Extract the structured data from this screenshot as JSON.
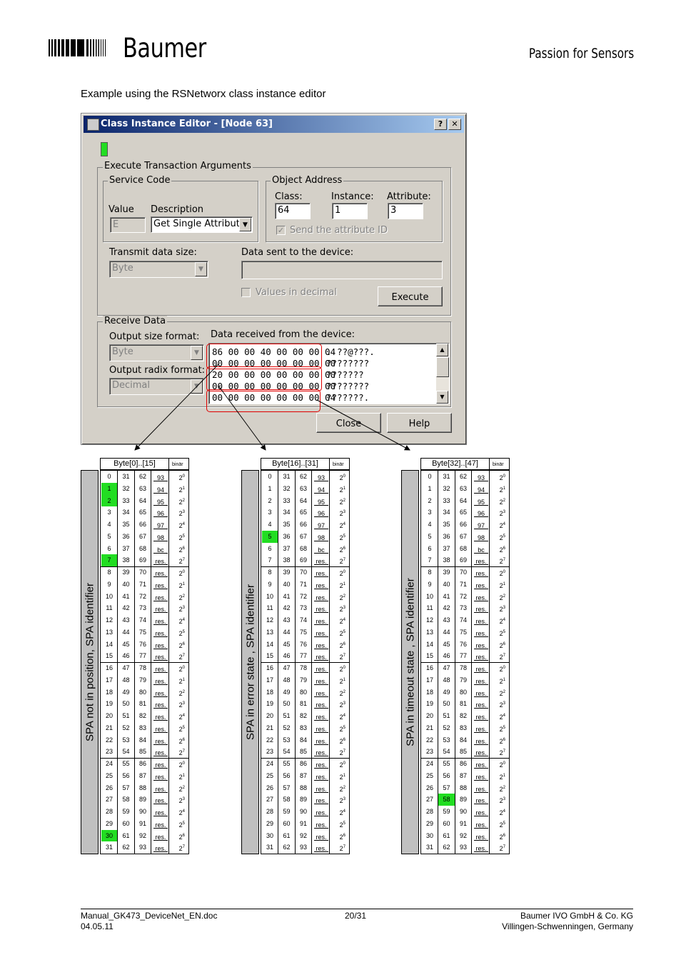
{
  "header": {
    "brand": "Baumer",
    "tagline": "Passion for Sensors"
  },
  "intro": "Example using the RSNetworx class instance editor",
  "dialog": {
    "title": "Class Instance Editor - [Node 63]",
    "help_btn": "?",
    "close_btn": "✕",
    "group_exec": "Execute Transaction Arguments",
    "group_service": "Service Code",
    "value_label": "Value",
    "value": "E",
    "desc_label": "Description",
    "desc_value": "Get Single Attribute",
    "group_object": "Object Address",
    "class_label": "Class:",
    "class_value": "64",
    "instance_label": "Instance:",
    "instance_value": "1",
    "attribute_label": "Attribute:",
    "attribute_value": "3",
    "send_attr_label": "Send the attribute ID",
    "transmit_label": "Transmit data size:",
    "transmit_value": "Byte",
    "data_sent_label": "Data sent to the device:",
    "values_decimal_label": "Values in decimal",
    "execute_btn": "Execute",
    "group_receive": "Receive Data",
    "output_size_label": "Output size format:",
    "output_size_value": "Byte",
    "output_radix_label": "Output radix format:",
    "output_radix_value": "Decimal",
    "data_received_label": "Data received from the device:",
    "data_lines": [
      {
        "hex": "86 00 00 40 00 00 00 04",
        "ascii": ". ??@???."
      },
      {
        "hex": "00 00 00 00 00 00 00 00",
        "ascii": "????????"
      },
      {
        "hex": "20 00 00 00 00 00 00 00",
        "ascii": " ???????"
      },
      {
        "hex": "00 00 00 00 00 00 00 00",
        "ascii": "????????"
      },
      {
        "hex": "00 00 00 00 00 00 00 04",
        "ascii": "???????."
      }
    ],
    "close_label": "Close",
    "help_label": "Help"
  },
  "tables": [
    {
      "title": "Byte[0]..[15]",
      "bin": "binär",
      "side": "SPA not in position,  SPA identifier",
      "green_col0": [
        1,
        2,
        7,
        30
      ],
      "green_col1": []
    },
    {
      "title": "Byte[16]..[31]",
      "bin": "binär",
      "side": "SPA in error state ,  SPA identifier",
      "green_col0": [
        5
      ],
      "green_col1": []
    },
    {
      "title": "Byte[32]..[47]",
      "bin": "binär",
      "side": "SPA in timeout state ,  SPA identifier",
      "green_col0": [],
      "green_col1": [
        27
      ]
    }
  ],
  "table_rows": [
    [
      "0",
      "31",
      "62",
      "93",
      "2",
      "0"
    ],
    [
      "1",
      "32",
      "63",
      "94",
      "2",
      "1"
    ],
    [
      "2",
      "33",
      "64",
      "95",
      "2",
      "2"
    ],
    [
      "3",
      "34",
      "65",
      "96",
      "2",
      "3"
    ],
    [
      "4",
      "35",
      "66",
      "97",
      "2",
      "4"
    ],
    [
      "5",
      "36",
      "67",
      "98",
      "2",
      "5"
    ],
    [
      "6",
      "37",
      "68",
      "bc",
      "2",
      "6"
    ],
    [
      "7",
      "38",
      "69",
      "res.",
      "2",
      "7"
    ],
    [
      "8",
      "39",
      "70",
      "res.",
      "2",
      "0"
    ],
    [
      "9",
      "40",
      "71",
      "res.",
      "2",
      "1"
    ],
    [
      "10",
      "41",
      "72",
      "res.",
      "2",
      "2"
    ],
    [
      "11",
      "42",
      "73",
      "res.",
      "2",
      "3"
    ],
    [
      "12",
      "43",
      "74",
      "res.",
      "2",
      "4"
    ],
    [
      "13",
      "44",
      "75",
      "res.",
      "2",
      "5"
    ],
    [
      "14",
      "45",
      "76",
      "res.",
      "2",
      "6"
    ],
    [
      "15",
      "46",
      "77",
      "res.",
      "2",
      "7"
    ],
    [
      "16",
      "47",
      "78",
      "res.",
      "2",
      "0"
    ],
    [
      "17",
      "48",
      "79",
      "res.",
      "2",
      "1"
    ],
    [
      "18",
      "49",
      "80",
      "res.",
      "2",
      "2"
    ],
    [
      "19",
      "50",
      "81",
      "res.",
      "2",
      "3"
    ],
    [
      "20",
      "51",
      "82",
      "res.",
      "2",
      "4"
    ],
    [
      "21",
      "52",
      "83",
      "res.",
      "2",
      "5"
    ],
    [
      "22",
      "53",
      "84",
      "res.",
      "2",
      "6"
    ],
    [
      "23",
      "54",
      "85",
      "res.",
      "2",
      "7"
    ],
    [
      "24",
      "55",
      "86",
      "res.",
      "2",
      "0"
    ],
    [
      "25",
      "56",
      "87",
      "res.",
      "2",
      "1"
    ],
    [
      "26",
      "57",
      "88",
      "res.",
      "2",
      "2"
    ],
    [
      "27",
      "58",
      "89",
      "res.",
      "2",
      "3"
    ],
    [
      "28",
      "59",
      "90",
      "res.",
      "2",
      "4"
    ],
    [
      "29",
      "60",
      "91",
      "res.",
      "2",
      "5"
    ],
    [
      "30",
      "61",
      "92",
      "res.",
      "2",
      "6"
    ],
    [
      "31",
      "62",
      "93",
      "res.",
      "2",
      "7"
    ]
  ],
  "footer": {
    "doc": "Manual_GK473_DeviceNet_EN.doc",
    "date": "04.05.11",
    "page": "20/31",
    "company": "Baumer IVO GmbH & Co. KG",
    "location": "Villingen-Schwenningen, Germany"
  }
}
